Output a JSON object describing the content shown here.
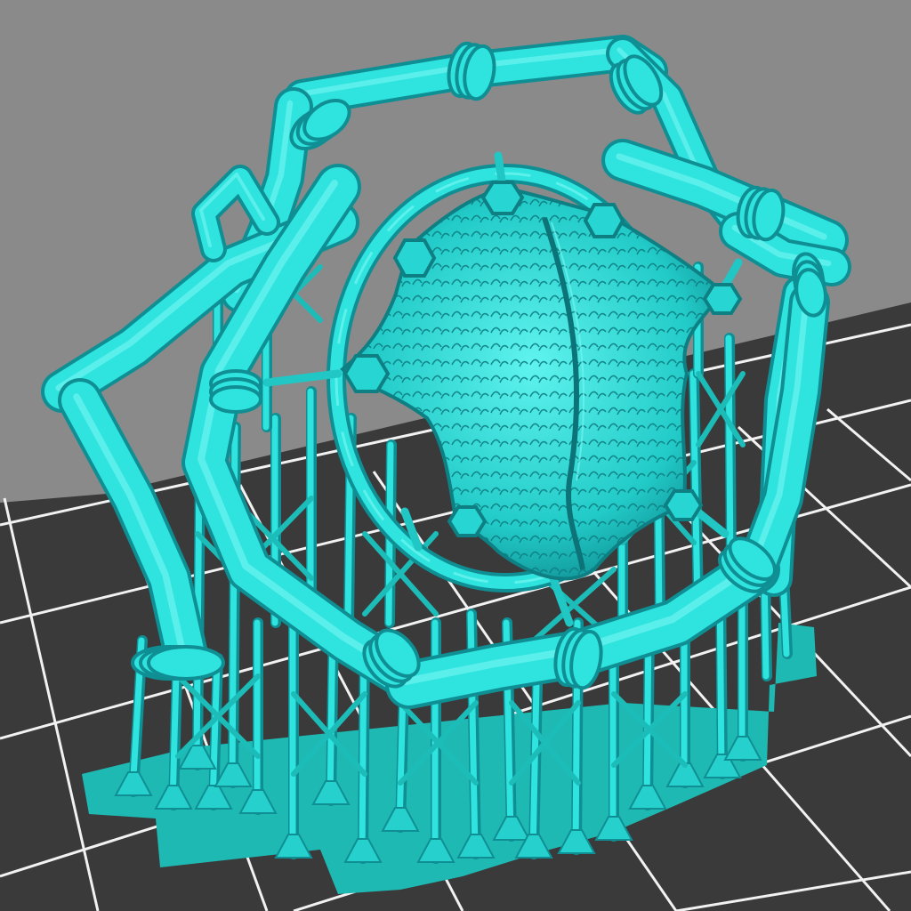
{
  "scene": {
    "background_color": "#8a8a8a",
    "build_plate": {
      "color": "#3a3a3a",
      "grid_line_color": "#f2f2f2"
    },
    "model": {
      "color": "#2fe3df",
      "shadow_color": "#0f8f93",
      "highlight_color": "#7ffaf4",
      "raft_color": "#1fb9b3",
      "parts": [
        "frame-ring",
        "inner-hoop",
        "hide-pelt",
        "support-lattice",
        "raft-base"
      ]
    }
  }
}
